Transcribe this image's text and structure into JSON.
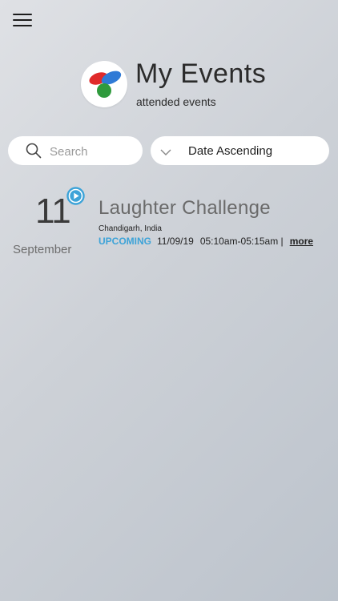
{
  "header": {
    "title": "My Events",
    "subtitle": "attended events"
  },
  "search": {
    "placeholder": "Search"
  },
  "sort": {
    "selected": "Date Ascending"
  },
  "colors": {
    "status_upcoming": "#3da3d8",
    "logo_red": "#e02a2a",
    "logo_blue": "#2f7ad6",
    "logo_green": "#2f9a3d"
  },
  "events": [
    {
      "day": "11",
      "month": "September",
      "title": "Laughter Challenge",
      "location": "Chandigarh, India",
      "status": "UPCOMING",
      "date": "11/09/19",
      "time": "05:10am-05:15am |",
      "more_label": "more"
    }
  ]
}
